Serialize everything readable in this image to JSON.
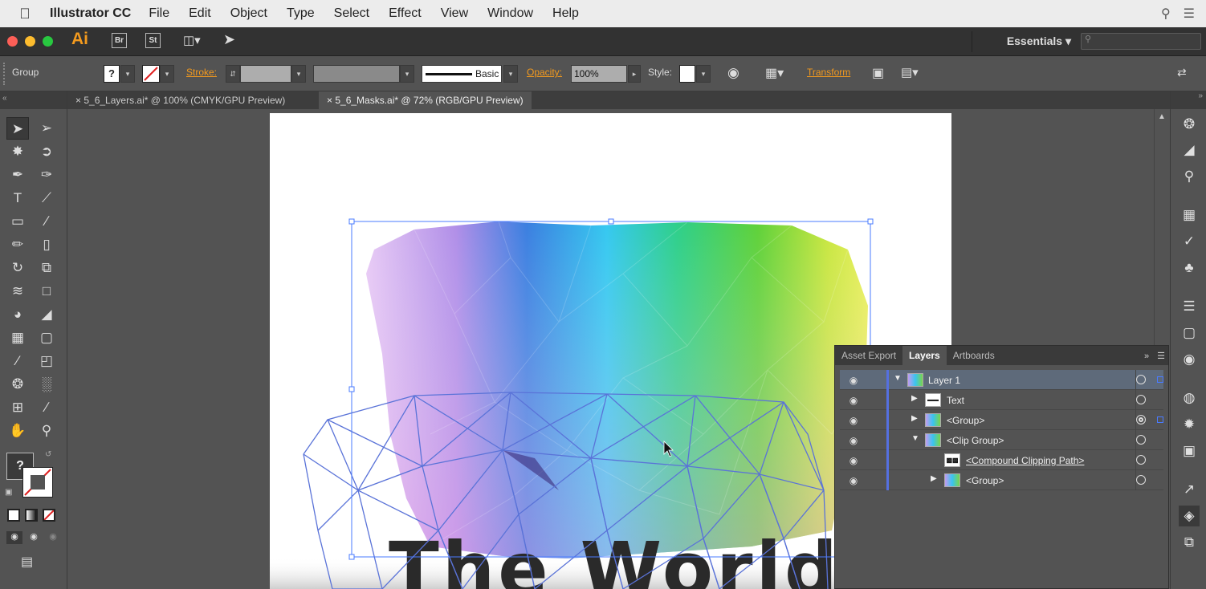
{
  "menubar": {
    "app_name": "Illustrator CC",
    "items": [
      "File",
      "Edit",
      "Object",
      "Type",
      "Select",
      "Effect",
      "View",
      "Window",
      "Help"
    ]
  },
  "appbar": {
    "logo": "Ai",
    "bridge": "Br",
    "stock": "St",
    "workspace": "Essentials"
  },
  "control": {
    "selection_type": "Group",
    "stroke_label": "Stroke:",
    "brush_profile": "Basic",
    "opacity_label": "Opacity:",
    "opacity_value": "100%",
    "style_label": "Style:",
    "transform_label": "Transform"
  },
  "tabs": [
    {
      "label": "5_6_Layers.ai* @ 100% (CMYK/GPU Preview)",
      "active": false
    },
    {
      "label": "5_6_Masks.ai* @ 72% (RGB/GPU Preview)",
      "active": true
    }
  ],
  "tools": {
    "unknown_fill": "?"
  },
  "artwork": {
    "headline": "The World"
  },
  "layers_panel": {
    "tabs": [
      "Asset Export",
      "Layers",
      "Artboards"
    ],
    "active_tab": "Layers",
    "rows": [
      {
        "name": "Layer 1",
        "level": 0,
        "twist": "open"
      },
      {
        "name": "Text",
        "level": 1,
        "twist": "closed"
      },
      {
        "name": "<Group>",
        "level": 1,
        "twist": "closed"
      },
      {
        "name": "<Clip Group>",
        "level": 1,
        "twist": "open"
      },
      {
        "name": "<Compound Clipping Path>",
        "level": 2,
        "twist": "none"
      },
      {
        "name": "<Group>",
        "level": 2,
        "twist": "closed"
      }
    ]
  },
  "colors": {
    "accent_orange": "#f39a1e",
    "selection_blue": "#4a7bff",
    "panel_bg": "#535353",
    "dark_bg": "#323232"
  }
}
